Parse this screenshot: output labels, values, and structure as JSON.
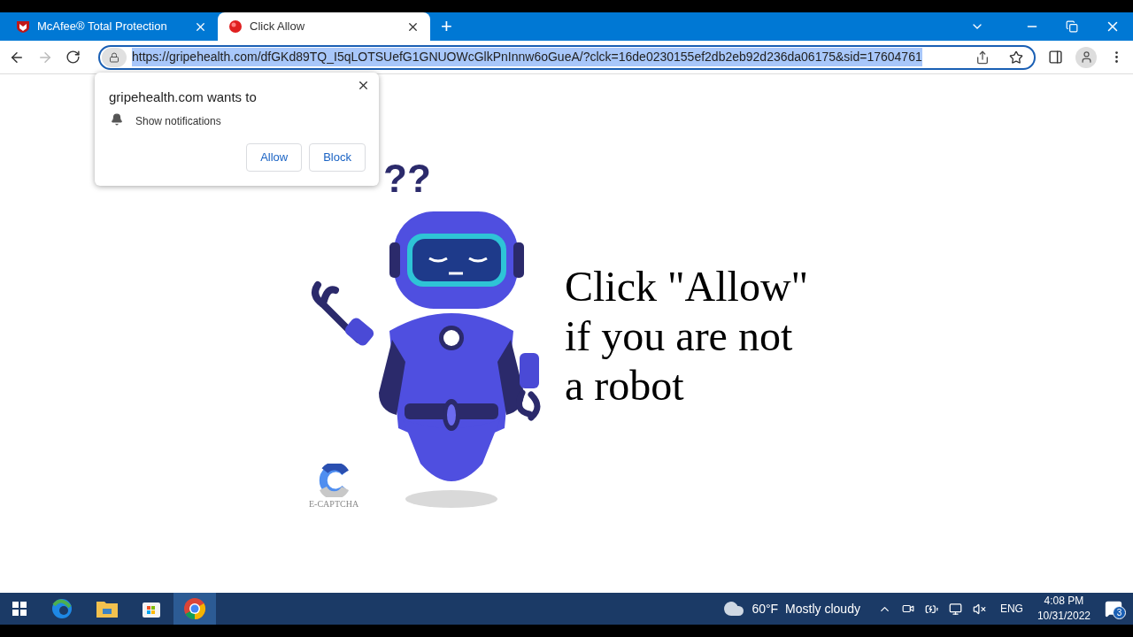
{
  "tabs": [
    {
      "title": "McAfee® Total Protection",
      "selected": false
    },
    {
      "title": "Click Allow",
      "selected": true
    }
  ],
  "new_tab": "+",
  "address_bar": {
    "url": "https://gripehealth.com/dfGKd89TQ_I5qLOTSUefG1GNUOWcGlkPnInnw6oGueA/?clck=16de0230155ef2db2eb92d236da06175&sid=17604761",
    "selected": true
  },
  "permission_popup": {
    "title": "gripehealth.com wants to",
    "permission": "Show notifications",
    "buttons": [
      "Allow",
      "Block"
    ]
  },
  "page": {
    "question_marks": "??",
    "headline": [
      "Click \"Allow\"",
      "if you are not",
      "a robot"
    ],
    "captcha_label": "E-CAPTCHA"
  },
  "taskbar": {
    "weather": {
      "temperature": "60°F",
      "condition": "Mostly cloudy"
    },
    "language": "ENG",
    "time": "4:08 PM",
    "date": "10/31/2022",
    "notification_count": "3"
  }
}
